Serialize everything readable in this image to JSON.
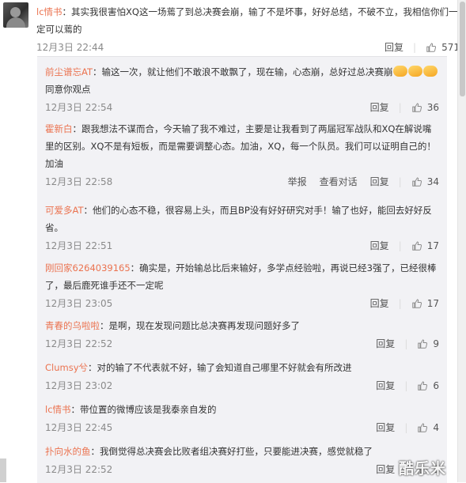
{
  "main_comment": {
    "username": "lc情书",
    "text": "：其实我很害怕XQ这一场蔫了到总决赛会崩，输了不是坏事，好好总结，不破不立，我相信你们一定可以蔫的",
    "time": "12月3日 22:44",
    "reply_label": "回复",
    "likes": "571"
  },
  "replies": [
    {
      "username": "前尘谱忘AT",
      "text": "：输这一次，就让他们不敢浪不敢飘了，现在输，心态崩，总好过总决赛崩",
      "suffix": "同意你观点",
      "emoji_after_text": 2,
      "emoji_before_suffix": 1,
      "time": "12月3日 22:54",
      "actions": [
        "回复"
      ],
      "likes": "36"
    },
    {
      "username": "霍新白",
      "text": "：跟我想法不谋而合，今天输了我不难过，主要是让我看到了两届冠军战队和XQ在解说嘴里的区别。XQ不是有短板，而是需要调整心态。加油，XQ，每一个队员。我们可以证明自己的！加油",
      "time": "12月3日 22:58",
      "actions": [
        "举报",
        "查看对话",
        "回复"
      ],
      "likes": "34"
    },
    {
      "username": "可爱多AT",
      "text": "：他们的心态不稳，很容易上头，而且BP没有好好研究对手！输了也好，能回去好好反省。",
      "time": "12月3日 22:51",
      "actions": [
        "回复"
      ],
      "likes": "17"
    },
    {
      "username": "刚回家6264039165",
      "text": "：确实是，开始输总比后来输好，多学点经验啦，再说已经3强了，已经很棒了，最后鹿死谁手还不一定呢",
      "time": "12月3日 23:05",
      "actions": [
        "回复"
      ],
      "likes": "17"
    },
    {
      "username": "青春的乌啦啦",
      "text": "：是啊，现在发现问题比总决赛再发现问题好多了",
      "time": "12月3日 22:52",
      "actions": [
        "回复"
      ],
      "likes": "9"
    },
    {
      "username": "Clumsy兮",
      "text": "：对的输了不代表就不好，输了会知道自己哪里不好就会有所改进",
      "time": "12月3日 23:02",
      "actions": [
        "回复"
      ],
      "likes": "6"
    },
    {
      "username": "lc情书",
      "text": "：带位置的微博应该是我泰亲自发的",
      "time": "12月3日 22:45",
      "actions": [
        "回复"
      ],
      "likes": "4"
    },
    {
      "username": "扑向水的鱼",
      "text": "：我倒觉得总决赛会比败者组决赛好打些，只要能进决赛，感觉就稳了",
      "time": "12月3日 22:52",
      "actions": [
        "回复"
      ],
      "likes": "5"
    }
  ],
  "watermark": "酷乐米",
  "colors": {
    "username": "#eb7350",
    "reply_bg": "#f2f2f5",
    "meta": "#8a8a8a"
  },
  "icons": {
    "like": "thumbs-up-icon",
    "avatar": "user-avatar"
  }
}
